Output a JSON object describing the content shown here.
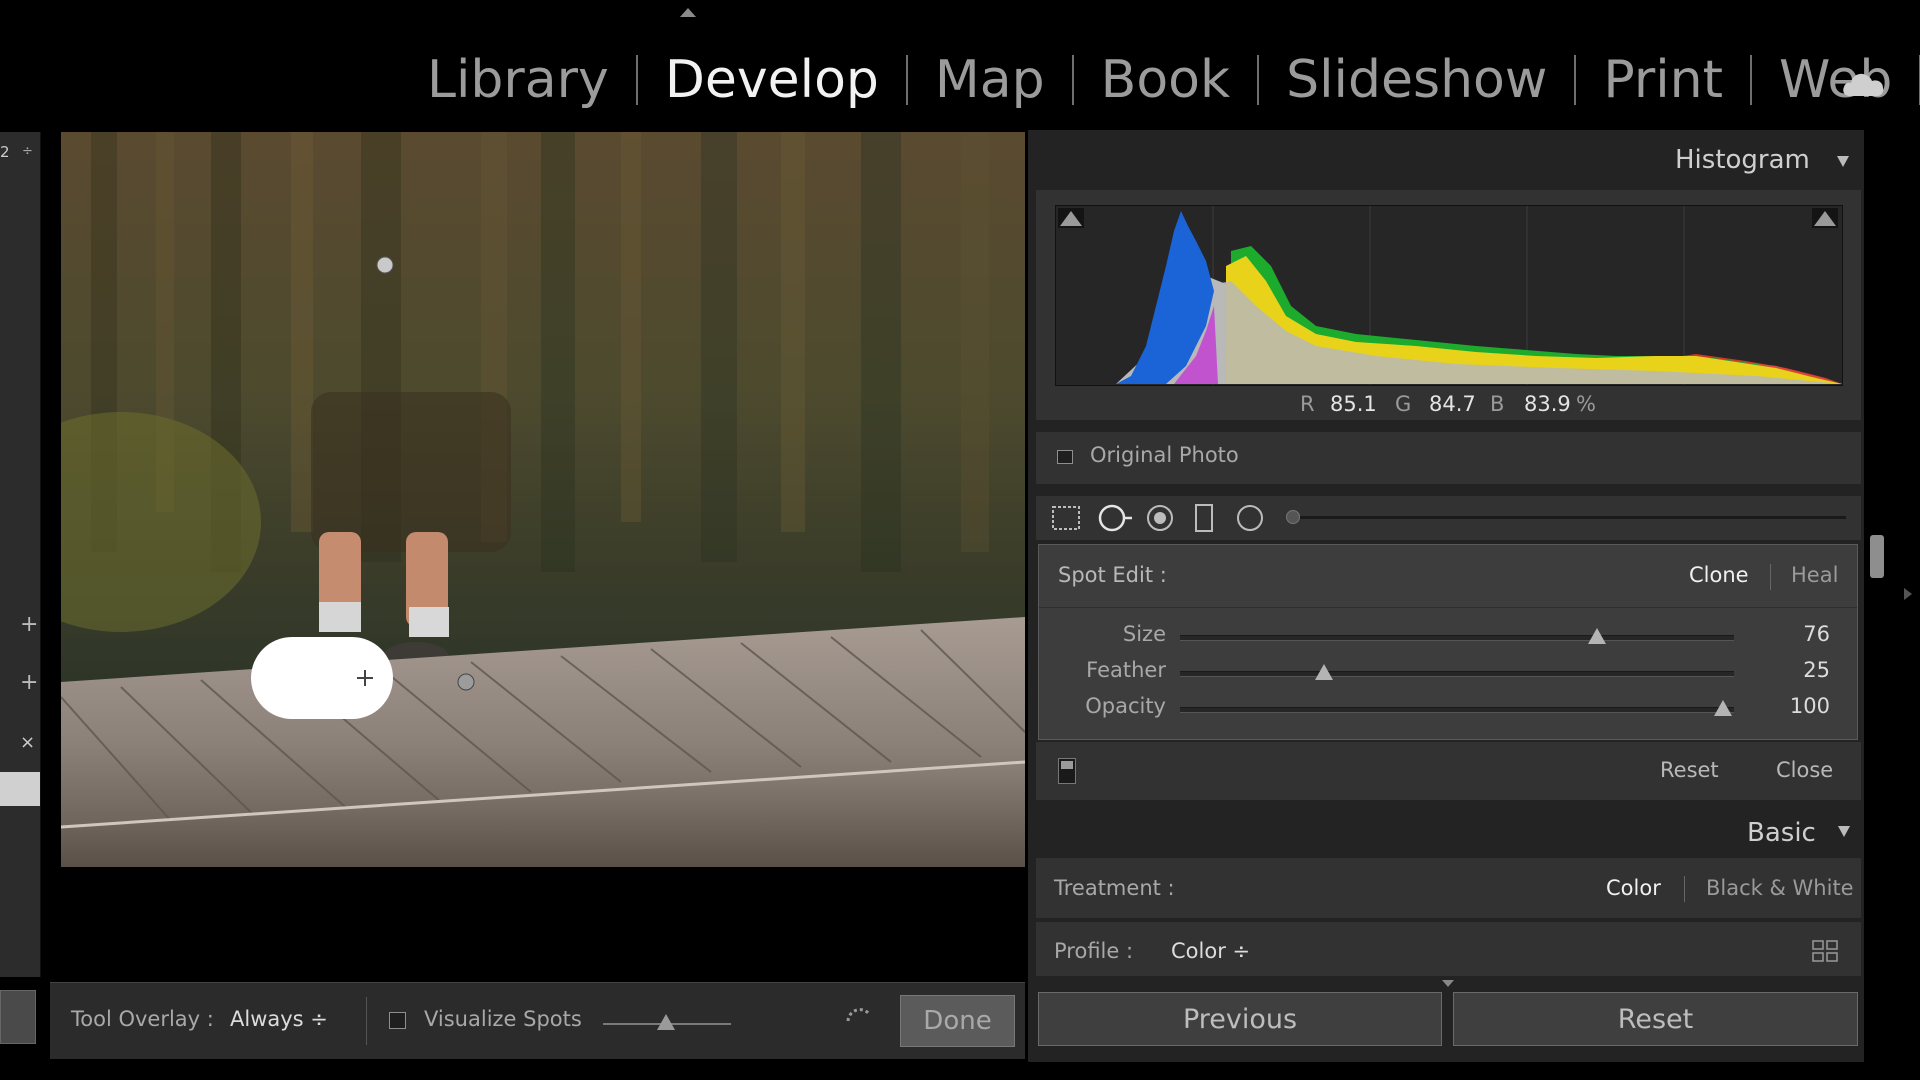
{
  "modules": [
    "Library",
    "Develop",
    "Map",
    "Book",
    "Slideshow",
    "Print",
    "Web"
  ],
  "active_module": "Develop",
  "left_strip": {
    "number_label": "2",
    "updown": "÷",
    "plus": "+",
    "close": "×"
  },
  "toolbar": {
    "tool_overlay_label": "Tool Overlay :",
    "tool_overlay_value": "Always ÷",
    "visualize_spots_label": "Visualize Spots",
    "visualize_spots_checked": false,
    "visualize_slider_value": 0.5,
    "done_label": "Done"
  },
  "histogram": {
    "title": "Histogram",
    "r_label": "R",
    "r_value": "85.1",
    "g_label": "G",
    "g_value": "84.7",
    "b_label": "B",
    "b_value": "83.9",
    "percent": "%",
    "original_photo_label": "Original Photo"
  },
  "tool_strip": {
    "icons": [
      "crop-overlay-icon",
      "spot-removal-icon",
      "red-eye-icon",
      "graduated-filter-icon",
      "radial-filter-icon"
    ]
  },
  "spot_edit": {
    "label": "Spot Edit :",
    "mode_clone": "Clone",
    "mode_heal": "Heal",
    "active_mode": "Clone",
    "sliders": [
      {
        "label": "Size",
        "value": "76",
        "fraction": 0.753
      },
      {
        "label": "Feather",
        "value": "25",
        "fraction": 0.26
      },
      {
        "label": "Opacity",
        "value": "100",
        "fraction": 0.98
      }
    ],
    "reset_label": "Reset",
    "close_label": "Close"
  },
  "basic": {
    "title": "Basic",
    "treatment_label": "Treatment :",
    "treatment_color": "Color",
    "treatment_bw": "Black & White",
    "profile_label": "Profile :",
    "profile_value": "Color ÷"
  },
  "buttons": {
    "previous": "Previous",
    "reset": "Reset"
  },
  "colors": {
    "background": "#000000",
    "panel": "#232323",
    "section": "#323232",
    "spot_box": "#3d3d3d",
    "active_text": "#f2f2f2",
    "inactive_text": "#9b9b9b",
    "hist_blue": "#1a64d8",
    "hist_yellow": "#e8d21a",
    "hist_green": "#1dab2d",
    "hist_red": "#e03a2a"
  }
}
